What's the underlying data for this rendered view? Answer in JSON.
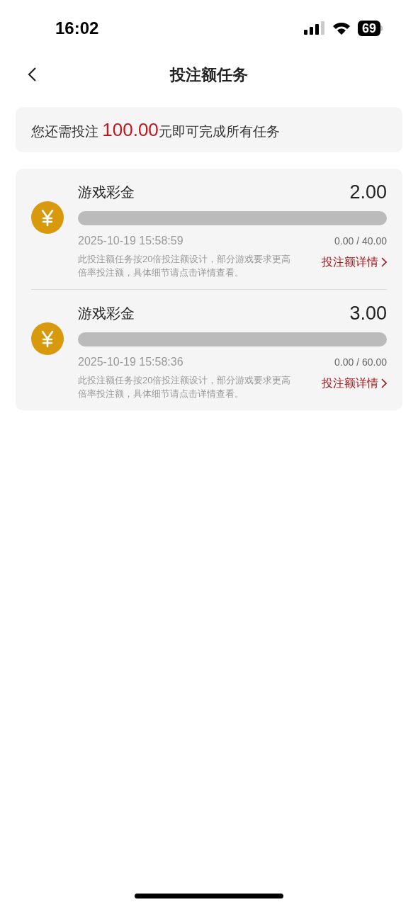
{
  "status_bar": {
    "time": "16:02",
    "battery": "69"
  },
  "header": {
    "title": "投注额任务"
  },
  "summary": {
    "prefix": "您还需投注 ",
    "amount": "100.00",
    "suffix": "元即可完成所有任务"
  },
  "tasks": [
    {
      "name": "游戏彩金",
      "amount": "2.00",
      "level": 0,
      "time": "2025-10-19 15:58:59",
      "progress": "0.00 / 40.00",
      "note": "此投注额任务按20倍投注额设计，部分游戏要求更高倍率投注额，具体细节请点击详情查看。",
      "link": "投注额详情"
    },
    {
      "name": "游戏彩金",
      "amount": "3.00",
      "level": 0,
      "time": "2025-10-19 15:58:36",
      "progress": "0.00 / 60.00",
      "note": "此投注额任务按20倍投注额设计，部分游戏要求更高倍率投注额，具体细节请点击详情查看。",
      "link": "投注额详情"
    }
  ]
}
